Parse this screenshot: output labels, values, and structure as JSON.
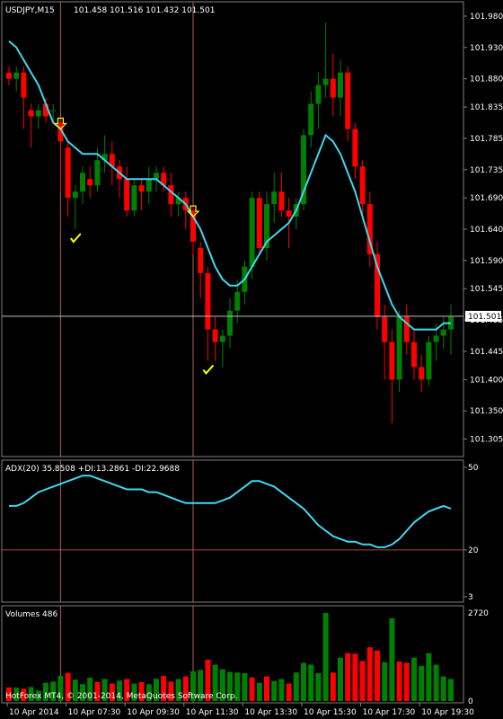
{
  "window": {
    "symbol": "USDJPY,M15",
    "ohlc": "101.458 101.516 101.432 101.501",
    "copyright": "HotForex MT4, © 2001-2014, MetaQuotes Software Corp."
  },
  "colors": {
    "background": "#000000",
    "bull": "#008000",
    "bear": "#ff0000",
    "ma_line": "#40d8f0",
    "adx_line": "#40d8f0",
    "grid": "#808080",
    "crosshair": "#c0c0c0",
    "signal": "#ffff00",
    "level_line": "#b04040"
  },
  "chart_data": [
    {
      "type": "candlestick",
      "title": "USDJPY,M15",
      "ylim": [
        101.28,
        102.0
      ],
      "y_ticks": [
        "101.980",
        "101.930",
        "101.880",
        "101.835",
        "101.785",
        "101.735",
        "101.690",
        "101.640",
        "101.590",
        "101.545",
        "101.495",
        "101.445",
        "101.400",
        "101.350",
        "101.305"
      ],
      "current_price": "101.501",
      "x_ticks": [
        "10 Apr 2014",
        "10 Apr 07:30",
        "10 Apr 09:30",
        "10 Apr 11:30",
        "10 Apr 13:30",
        "10 Apr 15:30",
        "10 Apr 17:30",
        "10 Apr 19:30"
      ],
      "x_tick_index": [
        0,
        8,
        16,
        24,
        32,
        40,
        48,
        56
      ],
      "crosshairs_index": [
        7,
        25
      ],
      "candles": [
        [
          101.89,
          101.9,
          101.87,
          101.88
        ],
        [
          101.88,
          101.9,
          101.86,
          101.89
        ],
        [
          101.89,
          101.9,
          101.8,
          101.85
        ],
        [
          101.83,
          101.84,
          101.77,
          101.82
        ],
        [
          101.82,
          101.84,
          101.8,
          101.83
        ],
        [
          101.84,
          101.85,
          101.81,
          101.82
        ],
        [
          101.83,
          101.84,
          101.81,
          101.83
        ],
        [
          101.81,
          101.82,
          101.7,
          101.78
        ],
        [
          101.77,
          101.78,
          101.66,
          101.69
        ],
        [
          101.69,
          101.71,
          101.64,
          101.7
        ],
        [
          101.7,
          101.74,
          101.68,
          101.73
        ],
        [
          101.72,
          101.74,
          101.69,
          101.71
        ],
        [
          101.71,
          101.77,
          101.7,
          101.75
        ],
        [
          101.75,
          101.79,
          101.73,
          101.76
        ],
        [
          101.76,
          101.78,
          101.71,
          101.74
        ],
        [
          101.74,
          101.75,
          101.69,
          101.72
        ],
        [
          101.72,
          101.74,
          101.66,
          101.67
        ],
        [
          101.67,
          101.72,
          101.66,
          101.71
        ],
        [
          101.71,
          101.72,
          101.67,
          101.7
        ],
        [
          101.7,
          101.74,
          101.68,
          101.72
        ],
        [
          101.72,
          101.74,
          101.7,
          101.73
        ],
        [
          101.73,
          101.74,
          101.7,
          101.71
        ],
        [
          101.71,
          101.73,
          101.66,
          101.68
        ],
        [
          101.68,
          101.7,
          101.66,
          101.69
        ],
        [
          101.69,
          101.7,
          101.64,
          101.67
        ],
        [
          101.67,
          101.68,
          101.6,
          101.62
        ],
        [
          101.61,
          101.62,
          101.53,
          101.57
        ],
        [
          101.57,
          101.58,
          101.43,
          101.48
        ],
        [
          101.48,
          101.5,
          101.43,
          101.46
        ],
        [
          101.46,
          101.48,
          101.42,
          101.47
        ],
        [
          101.47,
          101.53,
          101.45,
          101.51
        ],
        [
          101.51,
          101.56,
          101.49,
          101.54
        ],
        [
          101.54,
          101.59,
          101.52,
          101.58
        ],
        [
          101.58,
          101.7,
          101.56,
          101.69
        ],
        [
          101.69,
          101.7,
          101.6,
          101.61
        ],
        [
          101.61,
          101.7,
          101.59,
          101.68
        ],
        [
          101.68,
          101.73,
          101.65,
          101.7
        ],
        [
          101.7,
          101.73,
          101.66,
          101.67
        ],
        [
          101.67,
          101.69,
          101.61,
          101.66
        ],
        [
          101.66,
          101.69,
          101.64,
          101.68
        ],
        [
          101.68,
          101.8,
          101.67,
          101.79
        ],
        [
          101.79,
          101.86,
          101.77,
          101.84
        ],
        [
          101.84,
          101.89,
          101.8,
          101.87
        ],
        [
          101.87,
          101.97,
          101.85,
          101.88
        ],
        [
          101.88,
          101.92,
          101.82,
          101.85
        ],
        [
          101.85,
          101.91,
          101.82,
          101.89
        ],
        [
          101.89,
          101.9,
          101.78,
          101.8
        ],
        [
          101.8,
          101.81,
          101.72,
          101.74
        ],
        [
          101.74,
          101.75,
          101.66,
          101.68
        ],
        [
          101.68,
          101.7,
          101.58,
          101.6
        ],
        [
          101.6,
          101.62,
          101.48,
          101.5
        ],
        [
          101.5,
          101.52,
          101.4,
          101.46
        ],
        [
          101.46,
          101.48,
          101.33,
          101.4
        ],
        [
          101.4,
          101.51,
          101.38,
          101.5
        ],
        [
          101.5,
          101.52,
          101.44,
          101.46
        ],
        [
          101.46,
          101.48,
          101.4,
          101.42
        ],
        [
          101.42,
          101.44,
          101.38,
          101.4
        ],
        [
          101.4,
          101.47,
          101.39,
          101.46
        ],
        [
          101.46,
          101.49,
          101.43,
          101.47
        ],
        [
          101.47,
          101.5,
          101.45,
          101.48
        ],
        [
          101.48,
          101.52,
          101.44,
          101.5
        ]
      ],
      "ma_values": [
        101.94,
        101.93,
        101.91,
        101.89,
        101.87,
        101.84,
        101.81,
        101.8,
        101.78,
        101.77,
        101.76,
        101.76,
        101.76,
        101.75,
        101.74,
        101.73,
        101.72,
        101.72,
        101.72,
        101.72,
        101.72,
        101.71,
        101.7,
        101.69,
        101.68,
        101.66,
        101.64,
        101.61,
        101.58,
        101.56,
        101.55,
        101.55,
        101.56,
        101.58,
        101.6,
        101.62,
        101.63,
        101.64,
        101.65,
        101.67,
        101.7,
        101.73,
        101.76,
        101.79,
        101.78,
        101.76,
        101.73,
        101.7,
        101.66,
        101.62,
        101.58,
        101.55,
        101.52,
        101.5,
        101.49,
        101.48,
        101.48,
        101.48,
        101.48,
        101.49,
        101.49
      ],
      "signals_down_index": [
        7,
        25
      ],
      "signals_check_index": [
        9,
        27
      ]
    },
    {
      "type": "line",
      "title": "ADX(20) 35.8508 +DI:13.2861 -DI:22.9688",
      "ylim": [
        3,
        50
      ],
      "y_ticks": [
        "50",
        "20",
        "3"
      ],
      "level": 20,
      "values": [
        36,
        36,
        37,
        39,
        41,
        42,
        43,
        44,
        45,
        46,
        47,
        47,
        46,
        45,
        44,
        43,
        42,
        42,
        42,
        41,
        41,
        40,
        39,
        38,
        37,
        37,
        37,
        37,
        37,
        38,
        39,
        41,
        43,
        45,
        45,
        44,
        43,
        41,
        39,
        37,
        35,
        32,
        29,
        27,
        25,
        24,
        23,
        23,
        22,
        22,
        21,
        21,
        22,
        24,
        27,
        30,
        32,
        34,
        35,
        36,
        35
      ]
    },
    {
      "type": "bar",
      "title": "Volumes 486",
      "ylim": [
        0,
        2720
      ],
      "y_ticks": [
        "2720",
        "0"
      ],
      "values": [
        420,
        410,
        380,
        430,
        320,
        560,
        600,
        780,
        870,
        660,
        520,
        720,
        590,
        680,
        540,
        630,
        680,
        540,
        580,
        520,
        690,
        780,
        600,
        680,
        760,
        920,
        960,
        1280,
        1120,
        980,
        900,
        880,
        860,
        730,
        560,
        760,
        620,
        680,
        540,
        880,
        1180,
        1120,
        860,
        2720,
        880,
        1340,
        1480,
        1460,
        1240,
        1660,
        1560,
        1200,
        2560,
        1220,
        1180,
        1340,
        1080,
        1480,
        1120,
        760,
        680
      ],
      "up": [
        0,
        1,
        0,
        1,
        1,
        1,
        1,
        1,
        0,
        1,
        1,
        1,
        0,
        1,
        0,
        1,
        0,
        1,
        0,
        1,
        1,
        0,
        0,
        1,
        0,
        1,
        1,
        0,
        1,
        1,
        1,
        1,
        1,
        0,
        1,
        0,
        1,
        1,
        0,
        1,
        1,
        1,
        1,
        1,
        0,
        1,
        0,
        0,
        0,
        0,
        0,
        1,
        1,
        0,
        0,
        1,
        1,
        1,
        1,
        1,
        1
      ]
    }
  ]
}
